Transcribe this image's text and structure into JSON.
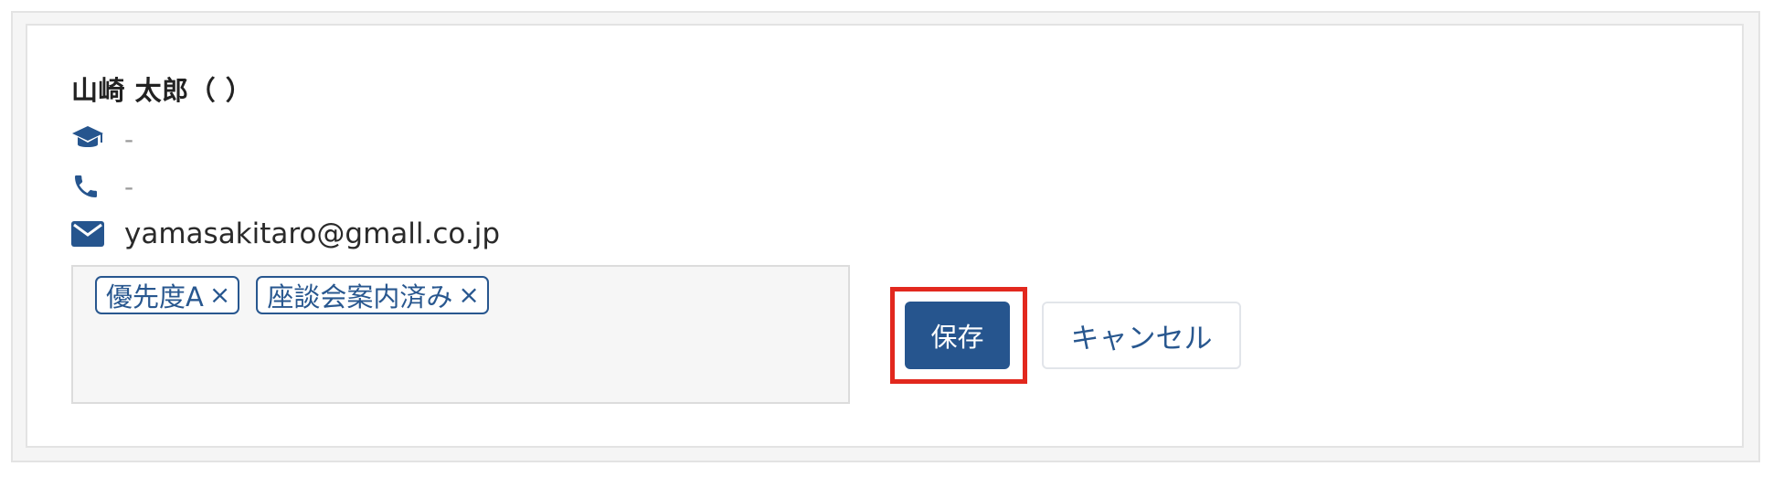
{
  "profile": {
    "name": "山崎 太郎（ ）",
    "school": "-",
    "phone": "-",
    "email": "yamasakitaro@gmall.co.jp"
  },
  "tags": [
    {
      "label": "優先度A",
      "remove": "×"
    },
    {
      "label": "座談会案内済み",
      "remove": "×"
    }
  ],
  "actions": {
    "save_label": "保存",
    "cancel_label": "キャンセル"
  },
  "colors": {
    "primary": "#26558e",
    "highlight": "#e2281e"
  },
  "icons": {
    "school": "graduation-cap-icon",
    "phone": "phone-icon",
    "email": "envelope-icon"
  }
}
